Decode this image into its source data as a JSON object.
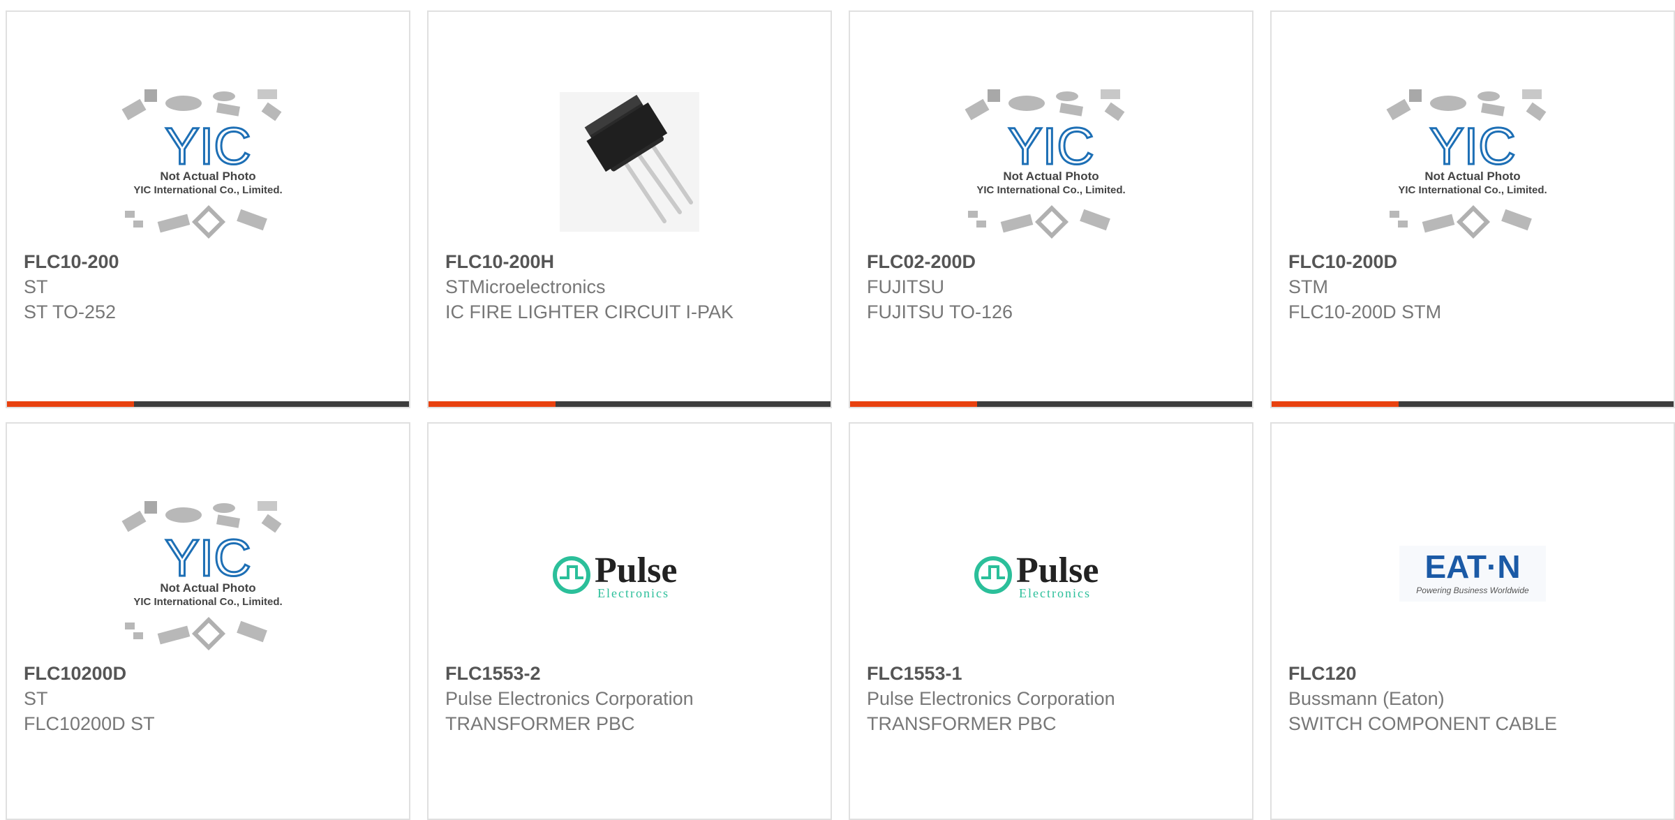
{
  "products": [
    {
      "part": "FLC10-200",
      "maker": "ST",
      "desc": "ST TO-252",
      "image": "yic-placeholder"
    },
    {
      "part": "FLC10-200H",
      "maker": "STMicroelectronics",
      "desc": "IC FIRE LIGHTER CIRCUIT I-PAK",
      "image": "to251-chip"
    },
    {
      "part": "FLC02-200D",
      "maker": "FUJITSU",
      "desc": "FUJITSU TO-126",
      "image": "yic-placeholder"
    },
    {
      "part": "FLC10-200D",
      "maker": "STM",
      "desc": "FLC10-200D STM",
      "image": "yic-placeholder"
    },
    {
      "part": "FLC10200D",
      "maker": "ST",
      "desc": "FLC10200D ST",
      "image": "yic-placeholder"
    },
    {
      "part": "FLC1553-2",
      "maker": "Pulse Electronics Corporation",
      "desc": "TRANSFORMER PBC",
      "image": "pulse-logo"
    },
    {
      "part": "FLC1553-1",
      "maker": "Pulse Electronics Corporation",
      "desc": "TRANSFORMER PBC",
      "image": "pulse-logo"
    },
    {
      "part": "FLC120",
      "maker": "Bussmann (Eaton)",
      "desc": "SWITCH COMPONENT CABLE",
      "image": "eaton-logo"
    }
  ],
  "placeholder": {
    "brand": "YIC",
    "line1": "Not Actual Photo",
    "line2": "YIC International Co., Limited."
  },
  "pulse_logo": {
    "word": "Pulse",
    "sub": "Electronics"
  },
  "eaton_logo": {
    "word": "EAT·N",
    "tagline": "Powering Business Worldwide"
  },
  "colors": {
    "accent": "#e8410f",
    "bar": "#3d3d3d",
    "border": "#e0e0e0",
    "pulse_teal": "#2bbf9a",
    "eaton_blue": "#1b5aa6",
    "yic_blue": "#1d6fb5"
  }
}
